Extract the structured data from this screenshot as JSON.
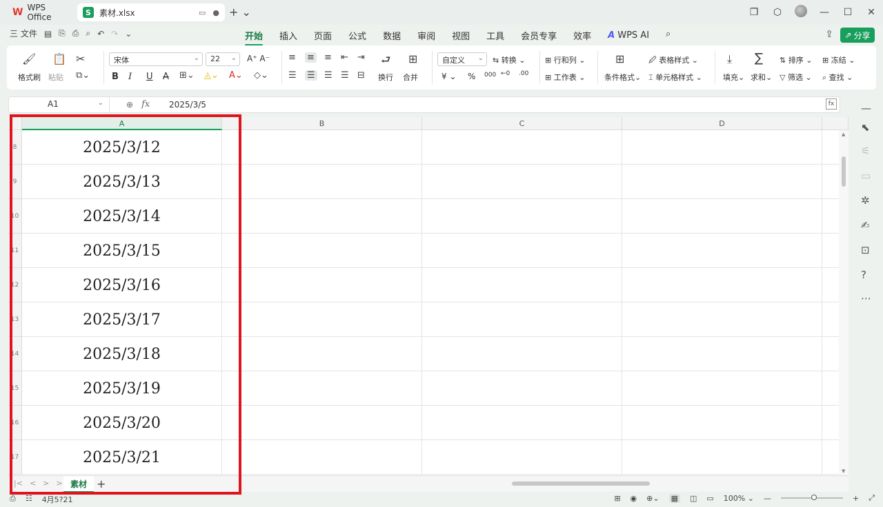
{
  "titlebar": {
    "app_tab": "WPS Office",
    "file_tab": "素材.xlsx"
  },
  "menubar": {
    "file_label": "三 文件",
    "tabs": [
      "开始",
      "插入",
      "页面",
      "公式",
      "数据",
      "审阅",
      "视图",
      "工具",
      "会员专享",
      "效率"
    ],
    "active_tab": "开始",
    "wps_ai": "WPS AI",
    "share": "分享"
  },
  "ribbon": {
    "format_painter": "格式刷",
    "paste": "粘贴",
    "font_name": "宋体",
    "font_size": "22",
    "bold": "B",
    "italic": "I",
    "underline": "U",
    "strike": "A",
    "wrap": "换行",
    "merge": "合并",
    "number_format": "自定义",
    "convert": "转换",
    "rows_cols": "行和列",
    "worksheet": "工作表",
    "cond_format": "条件格式",
    "table_style": "表格样式",
    "cell_style": "单元格样式",
    "fill": "填充",
    "sum": "求和",
    "sort": "排序",
    "filter": "筛选",
    "freeze": "冻结",
    "find": "查找",
    "currency": "¥",
    "percent": "%",
    "thousands": "000"
  },
  "formulabar": {
    "cell_ref": "A1",
    "value": "2025/3/5"
  },
  "grid": {
    "columns": [
      "A",
      "B",
      "C",
      "D"
    ],
    "row_numbers": [
      "8",
      "9",
      "10",
      "11",
      "12",
      "13",
      "14",
      "15",
      "16",
      "17"
    ],
    "column_a_values": [
      "2025/3/12",
      "2025/3/13",
      "2025/3/14",
      "2025/3/15",
      "2025/3/16",
      "2025/3/17",
      "2025/3/18",
      "2025/3/19",
      "2025/3/20",
      "2025/3/21"
    ]
  },
  "sheets": {
    "active": "素材"
  },
  "status": {
    "left_text": "4月5?21",
    "zoom": "100%"
  },
  "colors": {
    "accent": "#1a9e5c",
    "highlight": "#e0141e"
  }
}
